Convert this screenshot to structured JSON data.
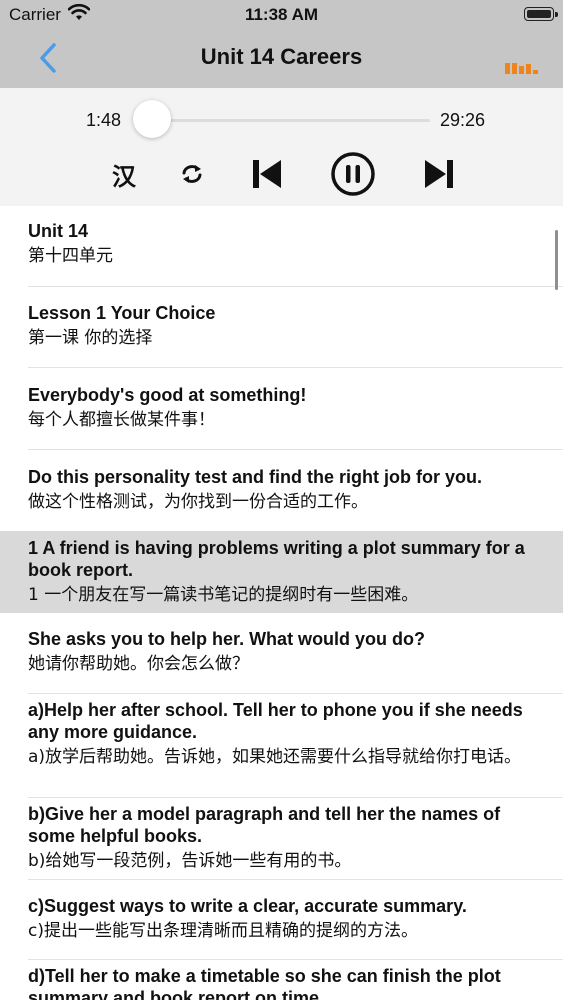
{
  "status_bar": {
    "carrier": "Carrier",
    "time": "11:38 AM"
  },
  "nav": {
    "title": "Unit 14 Careers",
    "back_icon": "chevron-left-icon",
    "menu_icon": "bars-icon"
  },
  "player": {
    "current_time": "1:48",
    "total_time": "29:26",
    "progress": 0.061,
    "controls": [
      "han-toggle",
      "repeat-icon",
      "skip-back-icon",
      "pause-icon",
      "skip-forward-icon"
    ],
    "han_label": "汉",
    "accent_color": "#3b8fe0"
  },
  "lines": [
    {
      "en": "Unit 14",
      "zh": "第十四单元"
    },
    {
      "en": "Lesson 1 Your Choice",
      "zh": "第一课 你的选择"
    },
    {
      "en": "Everybody's good at something!",
      "zh": "每个人都擅长做某件事！"
    },
    {
      "en": "Do this personality test and find the right job for you.",
      "zh": "做这个性格测试，为你找到一份合适的工作。"
    },
    {
      "en": "1 A friend is having problems writing a plot summary for a book report.",
      "zh": "1 一个朋友在写一篇读书笔记的提纲时有一些困难。"
    },
    {
      "en": "She asks you to help her. What would you do?",
      "zh": "她请你帮助她。你会怎么做？"
    },
    {
      "en": "a)Help her after school. Tell her to phone you if she needs any more guidance.",
      "zh": "a)放学后帮助她。告诉她，如果她还需要什么指导就给你打电话。"
    },
    {
      "en": "b)Give her a model paragraph and tell her the names of some helpful books.",
      "zh": "b)给她写一段范例，告诉她一些有用的书。"
    },
    {
      "en": "c)Suggest ways to write a clear, accurate summary.",
      "zh": "c)提出一些能写出条理清晰而且精确的提纲的方法。"
    },
    {
      "en": "d)Tell her to make a timetable so she can finish the plot summary and book report on time.",
      "zh": ""
    }
  ],
  "selected_line": 4
}
